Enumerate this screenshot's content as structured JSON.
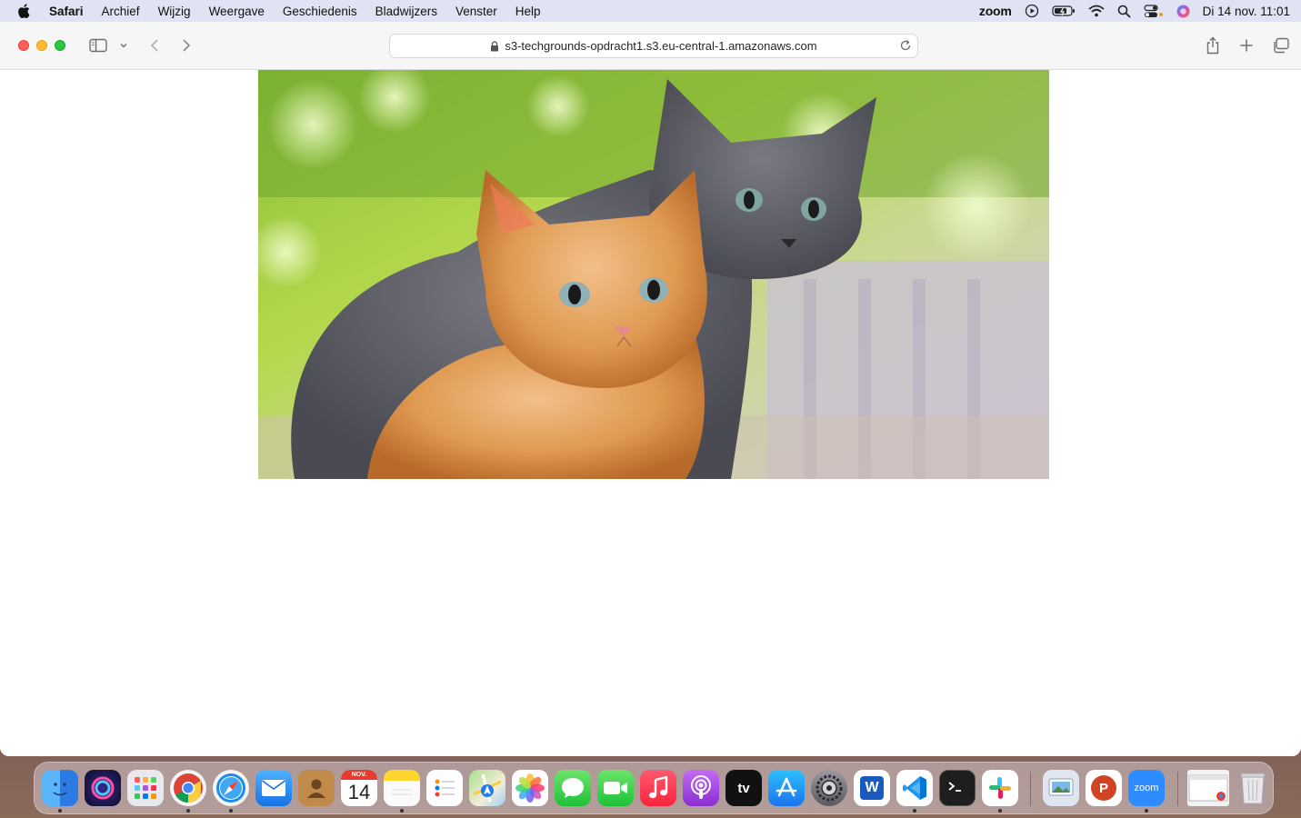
{
  "menubar": {
    "app_name": "Safari",
    "items": [
      "Archief",
      "Wijzig",
      "Weergave",
      "Geschiedenis",
      "Bladwijzers",
      "Venster",
      "Help"
    ],
    "zoom_label": "zoom",
    "clock": "Di 14 nov.  11:01"
  },
  "browser": {
    "url": "s3-techgrounds-opdracht1.s3.eu-central-1.amazonaws.com"
  },
  "page": {
    "image_subject": "two kittens (orange and grey)"
  },
  "dock": {
    "apps": [
      "Finder",
      "Siri",
      "Launchpad",
      "Chrome",
      "Safari",
      "Mail",
      "Contacts",
      "Calendar",
      "Notes",
      "Reminders",
      "Maps",
      "Photos",
      "Messages",
      "FaceTime",
      "Music",
      "Podcasts",
      "TV",
      "App Store",
      "System Settings",
      "Word",
      "VS Code",
      "Terminal",
      "Slack",
      "Preview",
      "PowerPoint",
      "Zoom",
      "Chrome Window",
      "Trash"
    ],
    "calendar_month": "NOV.",
    "calendar_day": "14",
    "tv_label": "tv",
    "zoom_label": "zoom",
    "word_label": "W",
    "ppt_label": "P"
  },
  "colors": {
    "close": "#ff5f57",
    "minimize": "#febc2e",
    "maximize": "#28c840",
    "menubar_bg": "#dfe3f3"
  }
}
